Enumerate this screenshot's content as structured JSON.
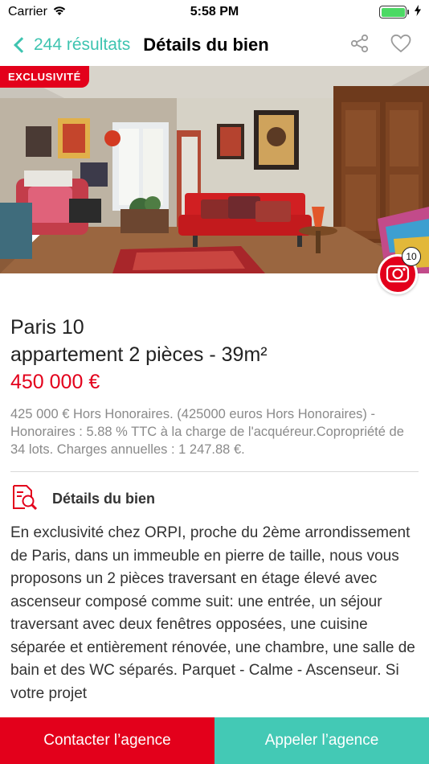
{
  "status_bar": {
    "carrier": "Carrier",
    "time": "5:58 PM"
  },
  "nav": {
    "back_label": "244 résultats",
    "title": "Détails du bien"
  },
  "hero": {
    "badge": "EXCLUSIVITÉ",
    "photo_count": "10"
  },
  "listing": {
    "city": "Paris 10",
    "property_type": "appartement 2 pièces - 39m²",
    "price": "450 000 €",
    "fees": "425 000 € Hors Honoraires.  (425000 euros Hors Honoraires) - Honoraires : 5.88 % TTC à la charge de l'acquéreur.Copropriété de 34 lots. Charges annuelles : 1 247.88 €."
  },
  "details": {
    "section_title": "Détails du bien",
    "description": "En exclusivité chez ORPI, proche du 2ème arrondissement de Paris, dans un immeuble en pierre de taille,  nous vous proposons un 2 pièces traversant en étage élevé avec ascenseur composé comme suit: une entrée, un séjour traversant avec deux fenêtres opposées, une cuisine séparée et entièrement rénovée, une chambre, une salle de bain et des WC séparés.  Parquet - Calme - Ascenseur.  Si votre projet"
  },
  "actions": {
    "contact_label": "Contacter l’agence",
    "call_label": "Appeler l’agence"
  },
  "colors": {
    "brand_red": "#e3001b",
    "accent_teal": "#43c9b5"
  }
}
